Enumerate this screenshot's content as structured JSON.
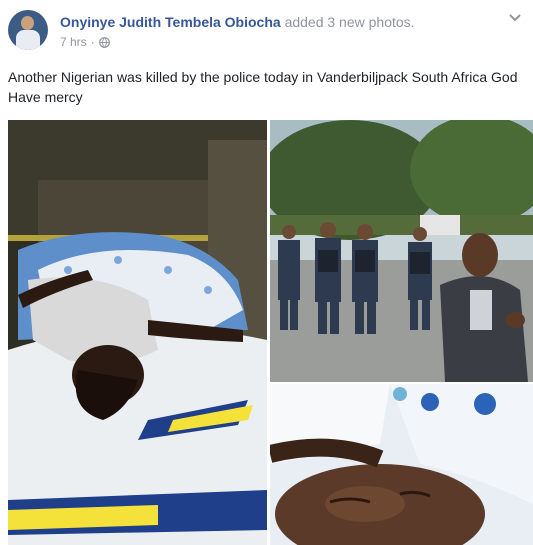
{
  "post": {
    "author": "Onyinye Judith Tembela Obiocha",
    "action": "added 3 new photos.",
    "time": "7 hrs",
    "separator": "·",
    "caption": "Another Nigerian was killed by the police today in Vanderbiljpack South Africa God Have mercy"
  },
  "icons": {
    "audience": "globe-icon",
    "menu": "chevron-down-icon"
  },
  "colors": {
    "author_link": "#365899",
    "meta_text": "#90949c",
    "body_text": "#1d2129"
  }
}
